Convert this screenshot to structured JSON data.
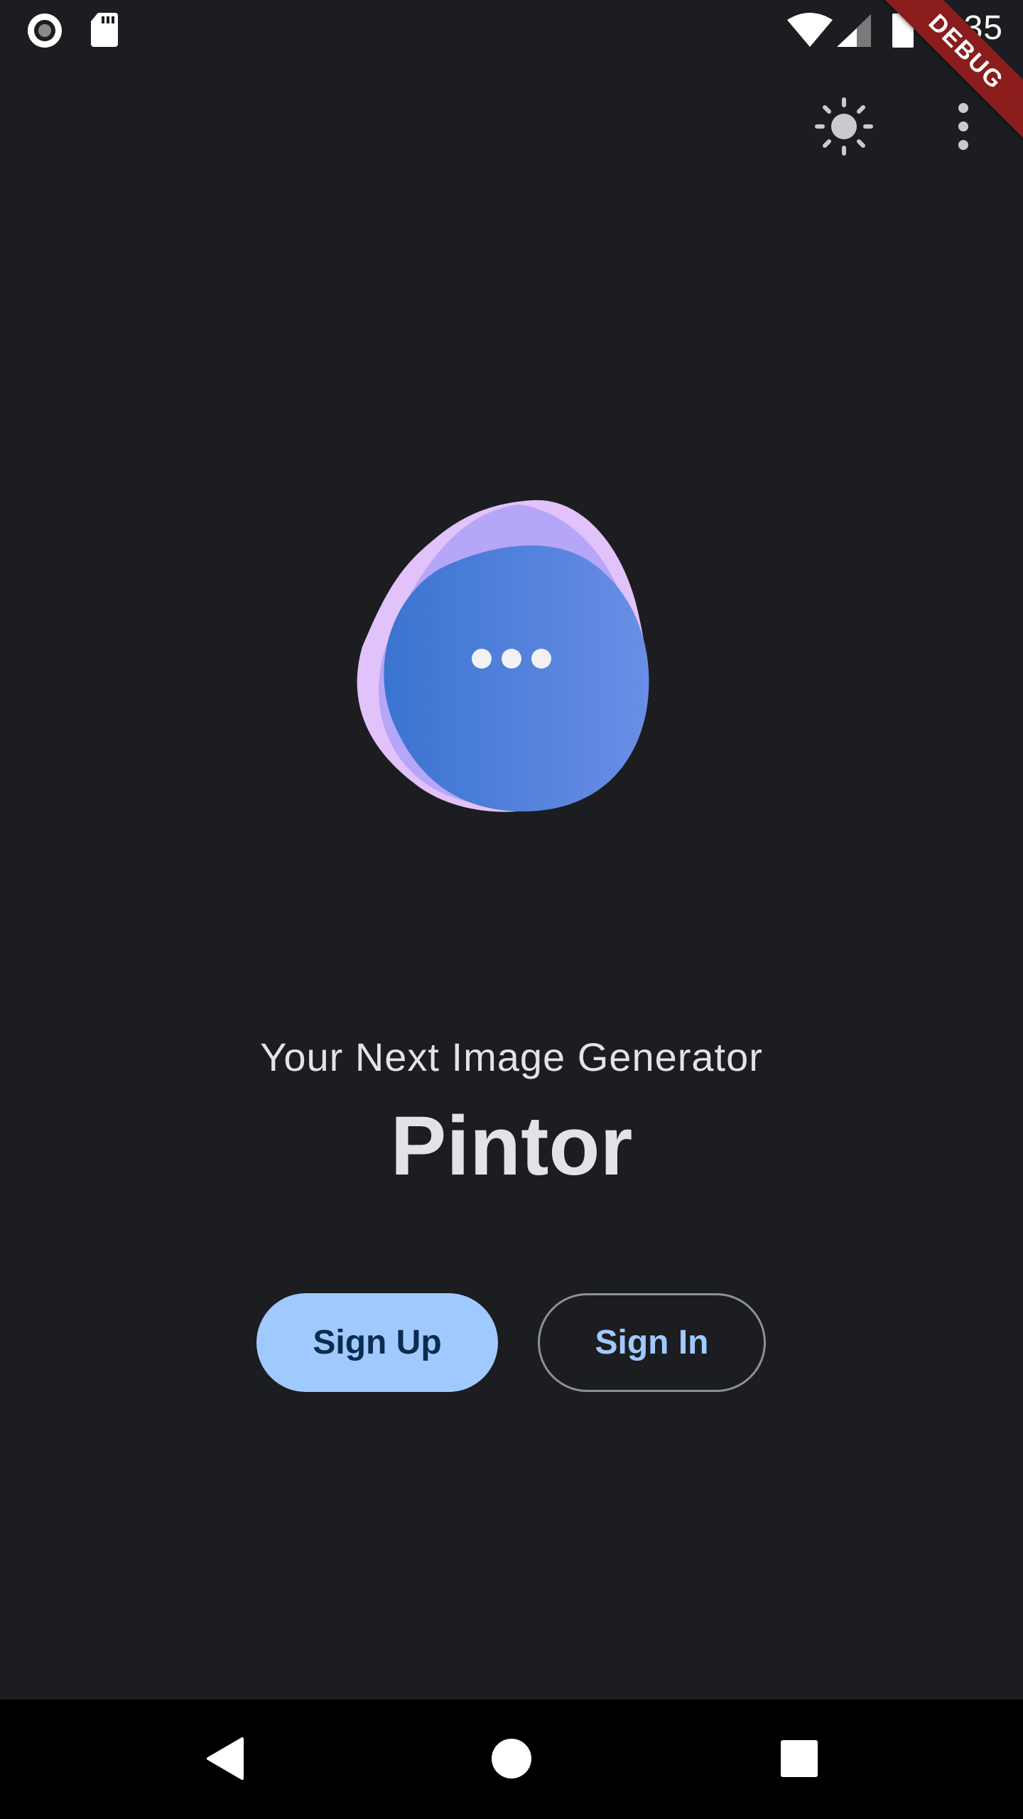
{
  "status_bar": {
    "time": "3:35",
    "icons": [
      "record-icon",
      "sd-card-icon",
      "wifi-icon",
      "cell-signal-icon",
      "battery-icon"
    ]
  },
  "debug_banner": {
    "label": "DEBUG",
    "color": "#8b1d1d"
  },
  "app_bar": {
    "actions": [
      "brightness-icon",
      "more-vert-icon"
    ]
  },
  "hero": {
    "icon": "chat-bubble-dots-icon",
    "colors": {
      "blob_light": "#e2c2fa",
      "blob_mid": "#b6a6f7",
      "blob_main": "#4a7fd9"
    }
  },
  "welcome": {
    "subtitle": "Your Next Image Generator",
    "title": "Pintor"
  },
  "buttons": {
    "sign_up": "Sign Up",
    "sign_in": "Sign In"
  },
  "colors": {
    "background": "#1c1d20",
    "primary": "#a0caff",
    "on_primary": "#0b2c4f",
    "outline": "#8e9099"
  },
  "nav_bar": {
    "items": [
      "back-icon",
      "home-icon",
      "recents-icon"
    ]
  }
}
